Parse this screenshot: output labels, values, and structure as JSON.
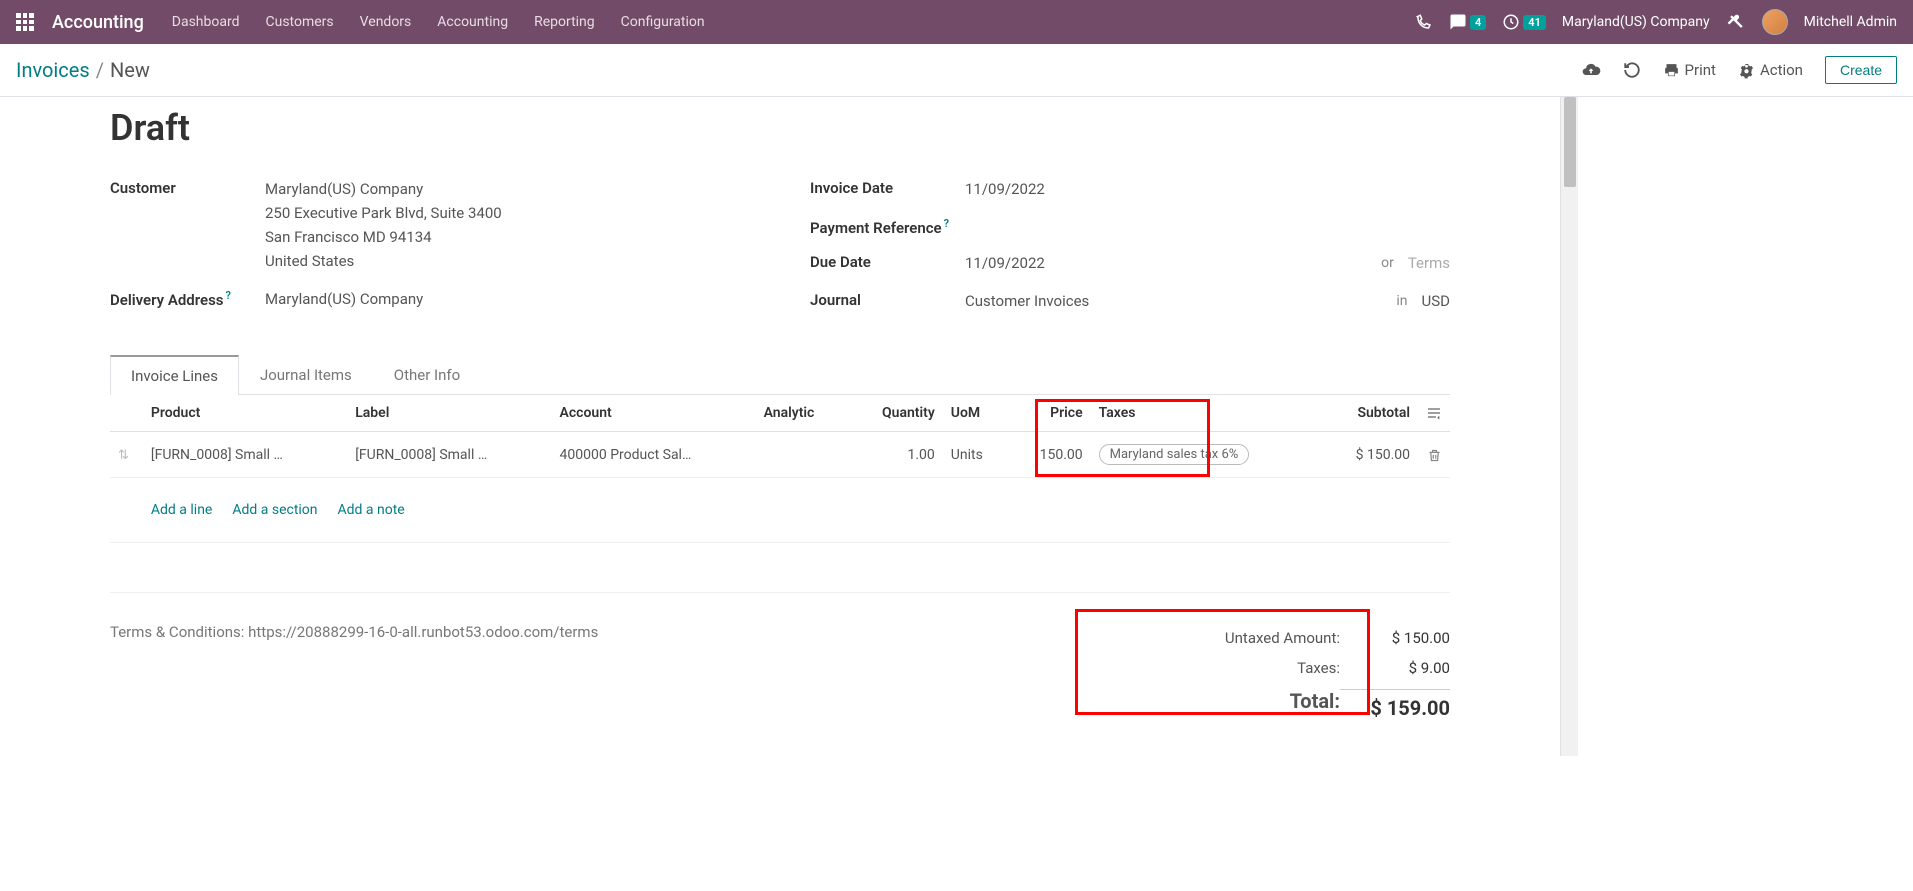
{
  "navbar": {
    "app_name": "Accounting",
    "menu": [
      "Dashboard",
      "Customers",
      "Vendors",
      "Accounting",
      "Reporting",
      "Configuration"
    ],
    "messages_badge": "4",
    "activities_badge": "41",
    "company": "Maryland(US) Company",
    "user": "Mitchell Admin"
  },
  "subheader": {
    "breadcrumb_root": "Invoices",
    "breadcrumb_current": "New",
    "print_label": "Print",
    "action_label": "Action",
    "create_label": "Create"
  },
  "form": {
    "title": "Draft",
    "customer_label": "Customer",
    "customer_name": "Maryland(US) Company",
    "customer_addr1": "250 Executive Park Blvd, Suite 3400",
    "customer_addr2": "San Francisco MD 94134",
    "customer_addr3": "United States",
    "delivery_label": "Delivery Address",
    "delivery_value": "Maryland(US) Company",
    "invoice_date_label": "Invoice Date",
    "invoice_date_value": "11/09/2022",
    "payment_ref_label": "Payment Reference",
    "due_date_label": "Due Date",
    "due_date_value": "11/09/2022",
    "or_label": "or",
    "terms_placeholder": "Terms",
    "journal_label": "Journal",
    "journal_value": "Customer Invoices",
    "in_label": "in",
    "currency_value": "USD"
  },
  "tabs": [
    "Invoice Lines",
    "Journal Items",
    "Other Info"
  ],
  "table": {
    "headers": {
      "product": "Product",
      "label": "Label",
      "account": "Account",
      "analytic": "Analytic",
      "quantity": "Quantity",
      "uom": "UoM",
      "price": "Price",
      "taxes": "Taxes",
      "subtotal": "Subtotal"
    },
    "rows": [
      {
        "product": "[FURN_0008] Small …",
        "label": "[FURN_0008] Small …",
        "account": "400000 Product Sal…",
        "analytic": "",
        "quantity": "1.00",
        "uom": "Units",
        "price": "150.00",
        "taxes": "Maryland sales tax 6%",
        "subtotal": "$ 150.00"
      }
    ],
    "add_line": "Add a line",
    "add_section": "Add a section",
    "add_note": "Add a note"
  },
  "footer": {
    "terms": "Terms & Conditions: https://20888299-16-0-all.runbot53.odoo.com/terms",
    "untaxed_label": "Untaxed Amount:",
    "untaxed_value": "$ 150.00",
    "taxes_label": "Taxes:",
    "taxes_value": "$ 9.00",
    "total_label": "Total:",
    "total_value": "$ 159.00"
  }
}
